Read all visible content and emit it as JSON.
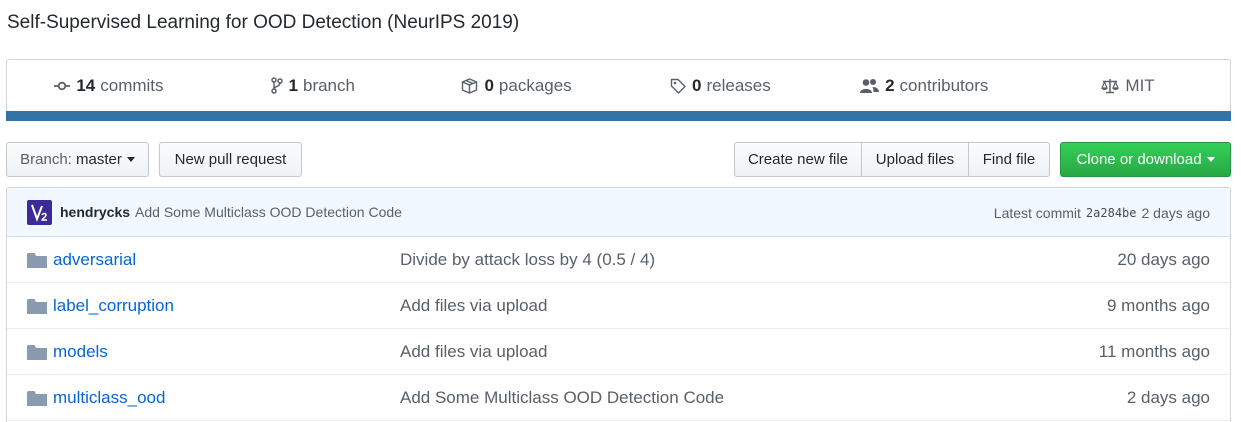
{
  "repo": {
    "description": "Self-Supervised Learning for OOD Detection (NeurIPS 2019)"
  },
  "summary": {
    "commits": {
      "count": "14",
      "label": "commits",
      "icon": "commit-icon"
    },
    "branches": {
      "count": "1",
      "label": "branch",
      "icon": "branch-icon"
    },
    "packages": {
      "count": "0",
      "label": "packages",
      "icon": "package-icon"
    },
    "releases": {
      "count": "0",
      "label": "releases",
      "icon": "tag-icon"
    },
    "contributors": {
      "count": "2",
      "label": "contributors",
      "icon": "people-icon"
    },
    "license": {
      "label": "MIT",
      "icon": "law-icon"
    },
    "language_color": "#3572A5"
  },
  "toolbar": {
    "branch_prefix": "Branch:",
    "branch_name": "master",
    "new_pull_request": "New pull request",
    "create_new_file": "Create new file",
    "upload_files": "Upload files",
    "find_file": "Find file",
    "clone_or_download": "Clone or download"
  },
  "latest_commit": {
    "author": "hendrycks",
    "message": "Add Some Multiclass OOD Detection Code",
    "label": "Latest commit",
    "sha": "2a284be",
    "age": "2 days ago"
  },
  "files": [
    {
      "name": "adversarial",
      "message": "Divide by attack loss by 4 (0.5 / 4)",
      "age": "20 days ago",
      "type": "folder"
    },
    {
      "name": "label_corruption",
      "message": "Add files via upload",
      "age": "9 months ago",
      "type": "folder"
    },
    {
      "name": "models",
      "message": "Add files via upload",
      "age": "11 months ago",
      "type": "folder"
    },
    {
      "name": "multiclass_ood",
      "message": "Add Some Multiclass OOD Detection Code",
      "age": "2 days ago",
      "type": "folder"
    }
  ]
}
